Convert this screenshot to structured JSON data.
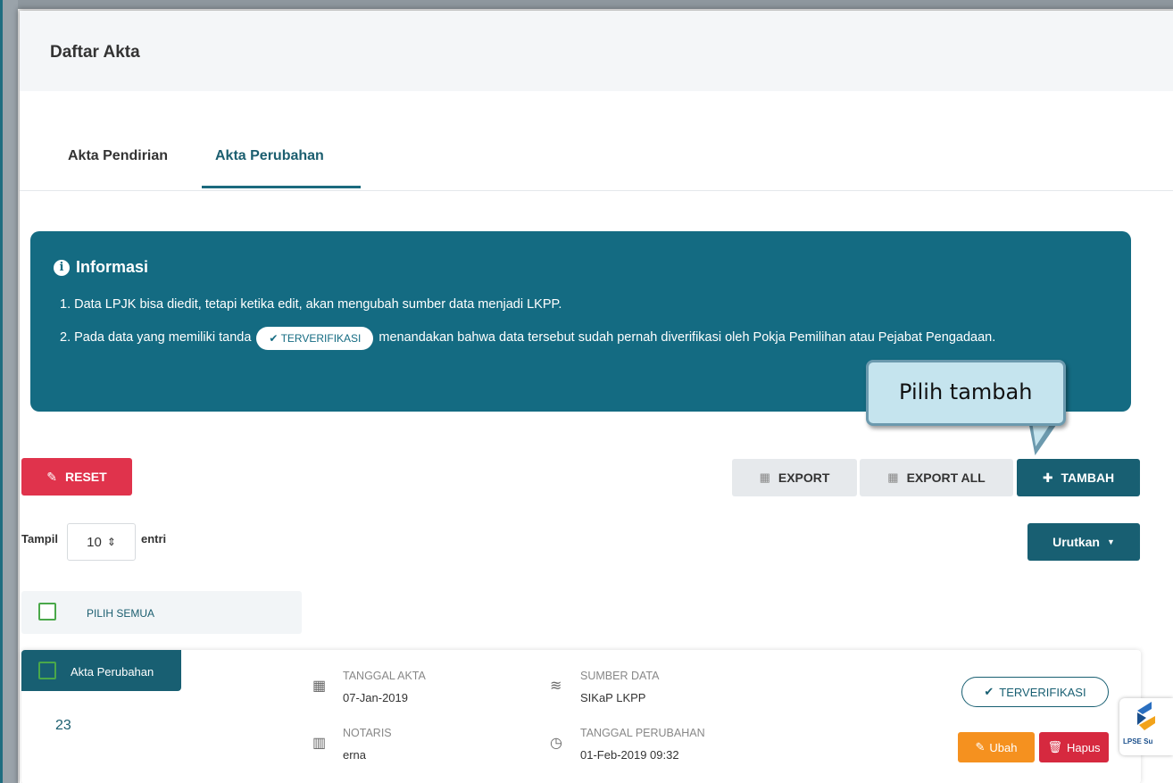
{
  "header": {
    "title": "Daftar Akta"
  },
  "tabs": [
    {
      "label": "Akta Pendirian",
      "active": false
    },
    {
      "label": "Akta Perubahan",
      "active": true
    }
  ],
  "info": {
    "heading": "Informasi",
    "line1": "1. Data LPJK bisa diedit, tetapi ketika edit, akan mengubah sumber data menjadi LKPP.",
    "line2_before": "2. Pada data yang memiliki tanda",
    "line2_badge": "TERVERIFIKASI",
    "line2_after": "menandakan bahwa data tersebut sudah pernah diverifikasi oleh Pokja Pemilihan atau Pejabat Pengadaan."
  },
  "callout": {
    "text": "Pilih tambah"
  },
  "toolbar": {
    "reset_label": "RESET",
    "export_label": "EXPORT",
    "export_all_label": "EXPORT ALL",
    "tambah_label": "TAMBAH"
  },
  "pagination": {
    "show_label": "Tampil",
    "page_size": "10",
    "entries_label": "entri",
    "sort_label": "Urutkan"
  },
  "select_all": {
    "label": "PILIH SEMUA"
  },
  "records": [
    {
      "type_label": "Akta Perubahan",
      "number": "23",
      "tanggal_akta_label": "TANGGAL AKTA",
      "tanggal_akta": "07-Jan-2019",
      "notaris_label": "NOTARIS",
      "notaris": "erna",
      "sumber_data_label": "SUMBER DATA",
      "sumber_data": "SIKaP LKPP",
      "tanggal_perubahan_label": "TANGGAL PERUBAHAN",
      "tanggal_perubahan": "01-Feb-2019 09:32",
      "status": "TERVERIFIKASI",
      "edit_label": "Ubah",
      "delete_label": "Hapus"
    }
  ],
  "badge": {
    "text": "LPSE Su"
  },
  "colors": {
    "primary": "#185f72",
    "info_bg": "#146b82",
    "reset": "#e0334c",
    "edit": "#f5911f",
    "delete": "#d6293f",
    "checkbox": "#4aa84a",
    "callout_bg": "#c5e4ee"
  }
}
